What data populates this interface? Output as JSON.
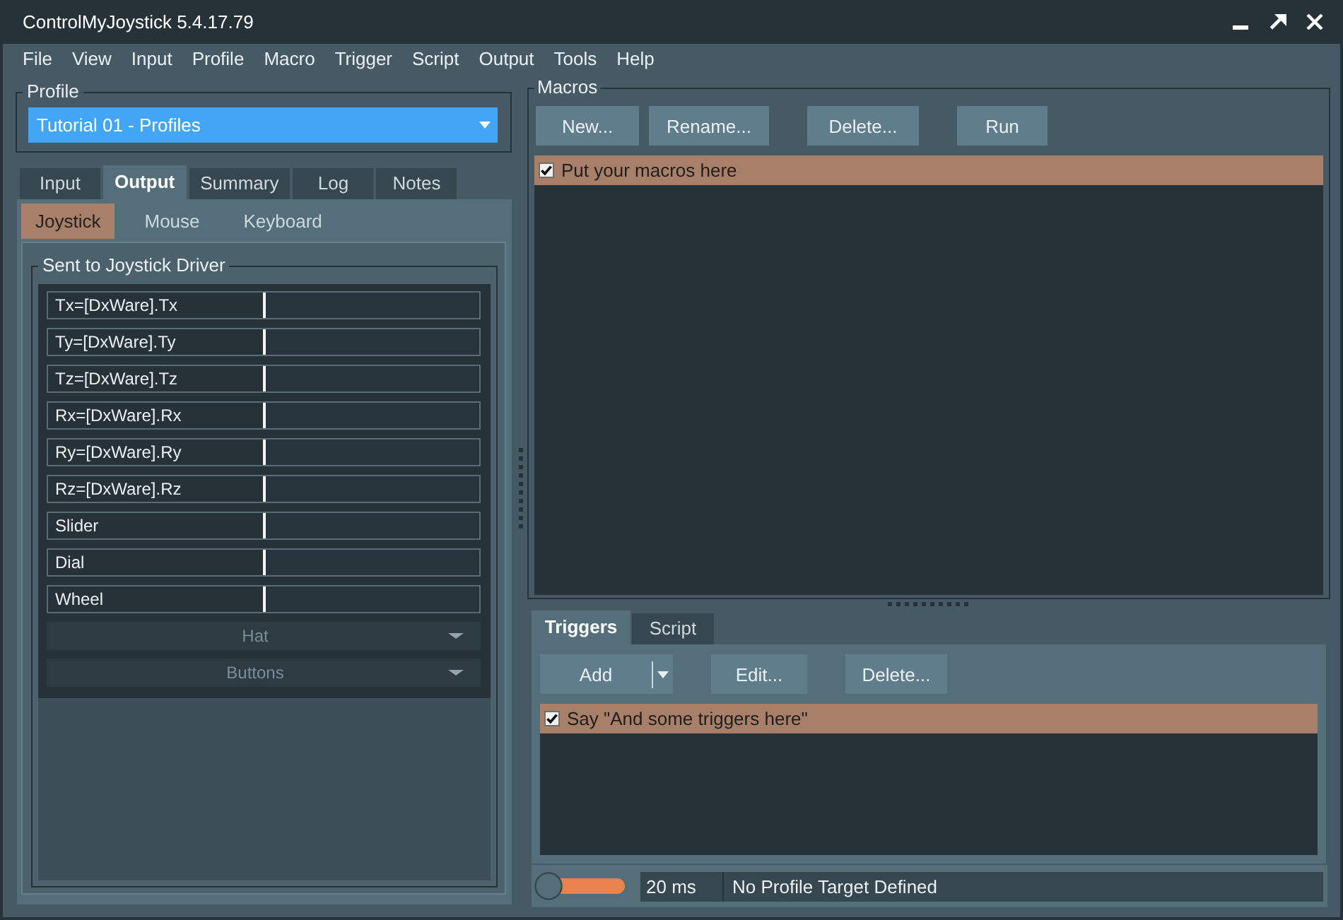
{
  "window": {
    "title": "ControlMyJoystick 5.4.17.79"
  },
  "menu": [
    "File",
    "View",
    "Input",
    "Profile",
    "Macro",
    "Trigger",
    "Script",
    "Output",
    "Tools",
    "Help"
  ],
  "profile": {
    "label": "Profile",
    "value": "Tutorial 01 - Profiles"
  },
  "left_tabs": [
    {
      "label": "Input",
      "selected": false
    },
    {
      "label": "Output",
      "selected": true
    },
    {
      "label": "Summary",
      "selected": false
    },
    {
      "label": "Log",
      "selected": false
    },
    {
      "label": "Notes",
      "selected": false
    }
  ],
  "output_tabs": [
    {
      "label": "Joystick",
      "selected": true
    },
    {
      "label": "Mouse",
      "selected": false
    },
    {
      "label": "Keyboard",
      "selected": false
    }
  ],
  "joystick_driver": {
    "title": "Sent to Joystick Driver",
    "rows": [
      {
        "kind": "axis",
        "label": "Tx=[DxWare].Tx",
        "level": 0
      },
      {
        "kind": "axis",
        "label": "Ty=[DxWare].Ty",
        "level": 0
      },
      {
        "kind": "axis",
        "label": "Tz=[DxWare].Tz",
        "level": 0
      },
      {
        "kind": "axis",
        "label": "Rx=[DxWare].Rx",
        "level": 0
      },
      {
        "kind": "axis",
        "label": "Ry=[DxWare].Ry",
        "level": 0
      },
      {
        "kind": "axis",
        "label": "Rz=[DxWare].Rz",
        "level": 0
      },
      {
        "kind": "axis",
        "label": "Slider",
        "level": 0
      },
      {
        "kind": "axis",
        "label": "Dial",
        "level": 0
      },
      {
        "kind": "axis",
        "label": "Wheel",
        "level": 0
      },
      {
        "kind": "dropdown",
        "label": "Hat",
        "disabled": true
      },
      {
        "kind": "dropdown",
        "label": "Buttons",
        "disabled": true
      }
    ]
  },
  "macros": {
    "title": "Macros",
    "buttons": [
      "New...",
      "Rename...",
      "Delete...",
      "Run"
    ],
    "items": [
      {
        "label": "Put your macros here",
        "checked": true,
        "selected": true
      }
    ]
  },
  "bottom_tabs": [
    {
      "label": "Triggers",
      "selected": true
    },
    {
      "label": "Script",
      "selected": false
    }
  ],
  "triggers": {
    "buttons": [
      {
        "kind": "split",
        "label": "Add"
      },
      {
        "kind": "plain",
        "label": "Edit..."
      },
      {
        "kind": "plain",
        "label": "Delete..."
      }
    ],
    "items": [
      {
        "label": "Say \"And some triggers here\"",
        "checked": true,
        "selected": true
      }
    ]
  },
  "status_bar": {
    "switch": {
      "on": true
    },
    "interval": "20 ms",
    "target": "No Profile Target Defined"
  }
}
